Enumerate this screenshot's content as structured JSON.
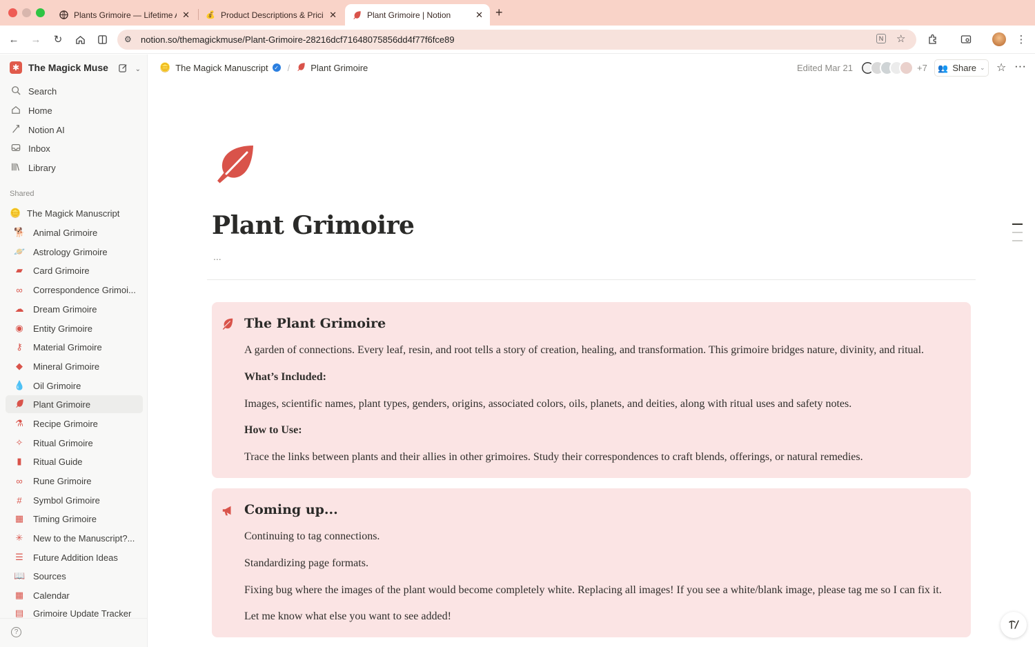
{
  "browser": {
    "tabs": [
      {
        "title": "Plants Grimoire — Lifetime Ac",
        "icon": "globe-icon"
      },
      {
        "title": "Product Descriptions & Pricin",
        "icon": "moneybag-icon"
      },
      {
        "title": "Plant Grimoire | Notion",
        "icon": "leaf-icon"
      }
    ],
    "url": "notion.so/themagickmuse/Plant-Grimoire-28216dcf71648075856dd4f77f6fce89"
  },
  "sidebar": {
    "workspace": "The Magick Muse",
    "nav": [
      {
        "label": "Search",
        "icon": "search-icon"
      },
      {
        "label": "Home",
        "icon": "home-icon"
      },
      {
        "label": "Notion AI",
        "icon": "ai-icon"
      },
      {
        "label": "Inbox",
        "icon": "inbox-icon"
      },
      {
        "label": "Library",
        "icon": "library-icon"
      }
    ],
    "section_label": "Shared",
    "root_page": "The Magick Manuscript",
    "pages": [
      {
        "label": "Animal Grimoire",
        "icon": "dog-icon"
      },
      {
        "label": "Astrology Grimoire",
        "icon": "planet-icon"
      },
      {
        "label": "Card Grimoire",
        "icon": "cards-icon"
      },
      {
        "label": "Correspondence Grimoi...",
        "icon": "link-icon"
      },
      {
        "label": "Dream Grimoire",
        "icon": "cloud-icon"
      },
      {
        "label": "Entity Grimoire",
        "icon": "eye-icon"
      },
      {
        "label": "Material Grimoire",
        "icon": "key-icon"
      },
      {
        "label": "Mineral Grimoire",
        "icon": "gem-icon"
      },
      {
        "label": "Oil Grimoire",
        "icon": "drop-icon"
      },
      {
        "label": "Plant Grimoire",
        "icon": "leaf-icon"
      },
      {
        "label": "Recipe Grimoire",
        "icon": "flask-icon"
      },
      {
        "label": "Ritual Grimoire",
        "icon": "wand-icon"
      },
      {
        "label": "Ritual Guide",
        "icon": "book-icon"
      },
      {
        "label": "Rune Grimoire",
        "icon": "infinity-icon"
      },
      {
        "label": "Symbol Grimoire",
        "icon": "hash-icon"
      },
      {
        "label": "Timing Grimoire",
        "icon": "calendar-icon"
      },
      {
        "label": "New to the Manuscript?...",
        "icon": "sparkle-icon"
      },
      {
        "label": "Future Addition Ideas",
        "icon": "list-icon"
      },
      {
        "label": "Sources",
        "icon": "open-book-icon"
      },
      {
        "label": "Calendar",
        "icon": "calendar-icon"
      },
      {
        "label": "Grimoire Update Tracker",
        "icon": "table-icon"
      }
    ]
  },
  "topbar": {
    "crumb_parent": "The Magick Manuscript",
    "crumb_current": "Plant Grimoire",
    "edited": "Edited Mar 21",
    "more_count": "+7",
    "share_label": "Share"
  },
  "page": {
    "title": "Plant Grimoire",
    "more": "...",
    "callout1": {
      "heading": "The Plant Grimoire",
      "intro": "A garden of connections. Every leaf, resin, and root tells a story of creation, healing, and transformation. This grimoire bridges nature, divinity, and ritual.",
      "included_label": "What’s Included:",
      "included_text": "Images, scientific names, plant types, genders, origins, associated colors, oils, planets, and deities, along with ritual uses and safety notes.",
      "howto_label": "How to Use:",
      "howto_text": "Trace the links between plants and their allies in other grimoires. Study their correspondences to craft blends, offerings, or natural remedies."
    },
    "callout2": {
      "heading": "Coming up...",
      "lines": [
        "Continuing to tag connections.",
        "Standardizing page formats.",
        "Fixing bug where the images of the plant would become completely white. Replacing all images! If you see a white/blank image, please tag me so I can fix it.",
        "Let me know what else you want to see added!"
      ]
    }
  },
  "colors": {
    "accent": "#d9534a",
    "callout_bg": "#fbe4e4",
    "tab_strip": "#f9d3c8"
  }
}
